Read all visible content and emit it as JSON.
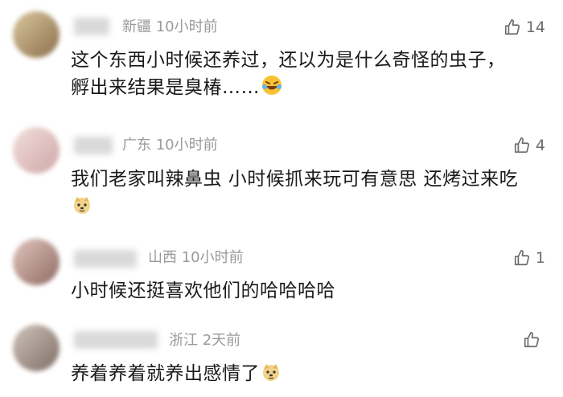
{
  "comments": [
    {
      "location": "新疆",
      "time": "10小时前",
      "likes": "14",
      "text": "这个东西小时候还养过，还以为是什么奇怪的虫子，孵出来结果是臭椿……",
      "emoji": "laughing-crying-emoji",
      "avatar_color": "#b9a27a"
    },
    {
      "location": "广东",
      "time": "10小时前",
      "likes": "4",
      "text": "我们老家叫辣鼻虫 小时候抓来玩可有意思 还烤过来吃",
      "emoji": "doge-emoji",
      "avatar_color": "#e7c9c9"
    },
    {
      "location": "山西",
      "time": "10小时前",
      "likes": "1",
      "text": "小时候还挺喜欢他们的哈哈哈哈",
      "emoji": "",
      "avatar_color": "#b99890"
    },
    {
      "location": "浙江",
      "time": "2天前",
      "likes": "",
      "text": "养着养着就养出感情了",
      "emoji": "doge-emoji",
      "avatar_color": "#a89a90"
    }
  ]
}
